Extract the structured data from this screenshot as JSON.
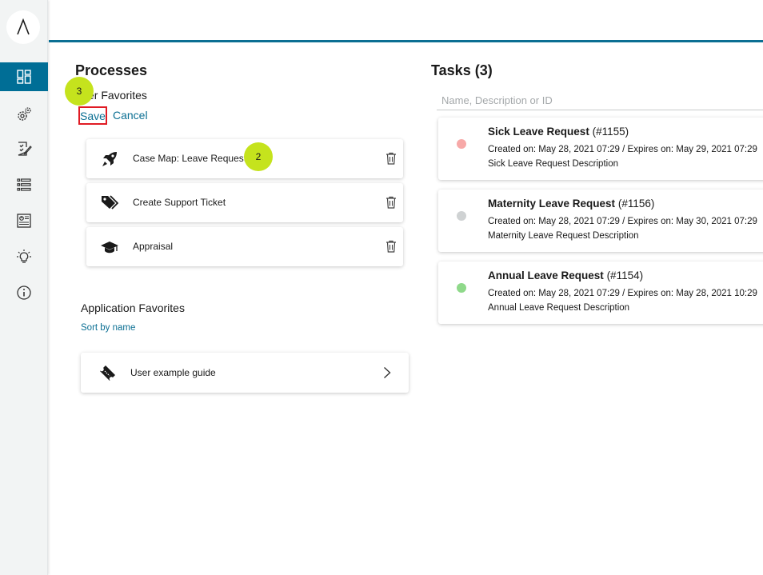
{
  "sidebar": {
    "logo": "Λ",
    "items": [
      {
        "icon": "dashboard-icon",
        "active": true
      },
      {
        "icon": "gears-icon",
        "active": false
      },
      {
        "icon": "checklist-doc-icon",
        "active": false
      },
      {
        "icon": "list-icon",
        "active": false
      },
      {
        "icon": "report-icon",
        "active": false
      },
      {
        "icon": "lightbulb-icon",
        "active": false
      },
      {
        "icon": "info-icon",
        "active": false
      }
    ]
  },
  "processes": {
    "title": "Processes",
    "user_favorites_title": "ser Favorites",
    "save_label": "Save",
    "cancel_label": "Cancel",
    "favorites": [
      {
        "label": "Case Map: Leave Request",
        "icon": "rocket-icon"
      },
      {
        "label": "Create Support Ticket",
        "icon": "tags-icon"
      },
      {
        "label": "Appraisal",
        "icon": "graduation-cap-icon"
      }
    ],
    "app_favorites_title": "Application Favorites",
    "sort_label": "Sort by name",
    "app_favorites": [
      {
        "label": "User example guide",
        "icon": "ticket-icon"
      }
    ]
  },
  "tasks": {
    "title": "Tasks (3)",
    "search_placeholder": "Name, Description or ID",
    "items": [
      {
        "name": "Sick Leave Request",
        "id": "(#1155)",
        "meta": "Created on: May 28, 2021 07:29 / Expires on: May 29, 2021 07:29",
        "description": "Sick Leave Request Description",
        "status_color": "#f7a9a8"
      },
      {
        "name": "Maternity Leave Request",
        "id": "(#1156)",
        "meta": "Created on: May 28, 2021 07:29 / Expires on: May 30, 2021 07:29",
        "description": "Maternity Leave Request Description",
        "status_color": "#cfd2d3"
      },
      {
        "name": "Annual Leave Request",
        "id": "(#1154)",
        "meta": "Created on: May 28, 2021 07:29 / Expires on: May 28, 2021 10:29",
        "description": "Annual Leave Request Description",
        "status_color": "#8fd98a"
      }
    ]
  },
  "badges": {
    "step3": "3",
    "step2": "2"
  },
  "colors": {
    "accent": "#0b6f93",
    "highlight_border": "#e01b24",
    "badge": "#c5e31d"
  }
}
